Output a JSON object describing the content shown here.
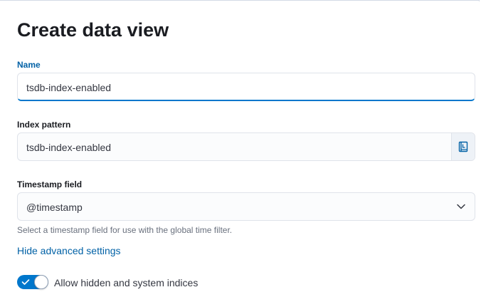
{
  "form": {
    "title": "Create data view",
    "name": {
      "label": "Name",
      "value": "tsdb-index-enabled"
    },
    "index_pattern": {
      "label": "Index pattern",
      "value": "tsdb-index-enabled",
      "append_icon": "book-icon"
    },
    "timestamp": {
      "label": "Timestamp field",
      "value": "@timestamp",
      "help": "Select a timestamp field for use with the global time filter.",
      "icon": "chevron-down-icon"
    },
    "advanced_link": "Hide advanced settings",
    "hidden_indices_toggle": {
      "label": "Allow hidden and system indices",
      "checked": true
    }
  },
  "colors": {
    "accent": "#0077cc",
    "active_label": "#0061a6",
    "text": "#1a1c21",
    "help_text": "#69707d"
  }
}
